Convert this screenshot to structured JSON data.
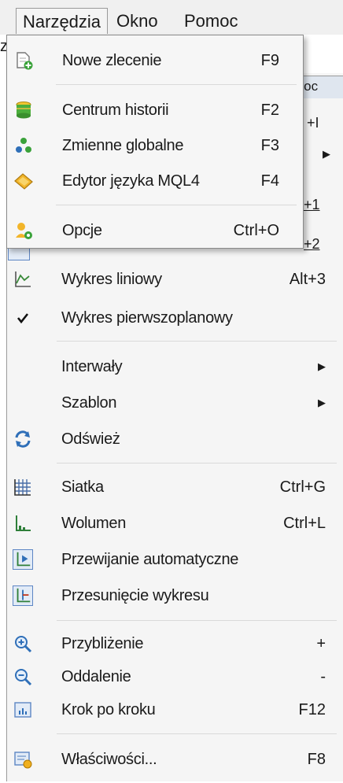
{
  "menubar": {
    "items": [
      {
        "label": "Narzędzia"
      },
      {
        "label": "Okno"
      },
      {
        "label": "Pomoc"
      }
    ]
  },
  "back_menu": {
    "partial_texts": [
      "moc",
      "+I",
      "+1",
      "+2"
    ],
    "items": [
      {
        "label": "Wykres liniowy",
        "shortcut": "Alt+3",
        "icon": "line-chart-icon"
      },
      {
        "label": "Wykres pierwszoplanowy",
        "shortcut": "",
        "icon": "checkmark-icon"
      },
      {
        "label": "Interwały",
        "shortcut": "",
        "submenu": true
      },
      {
        "label": "Szablon",
        "shortcut": "",
        "submenu": true
      },
      {
        "label": "Odśwież",
        "shortcut": "",
        "icon": "refresh-icon"
      },
      {
        "label": "Siatka",
        "shortcut": "Ctrl+G",
        "icon": "grid-icon"
      },
      {
        "label": "Wolumen",
        "shortcut": "Ctrl+L",
        "icon": "volume-icon"
      },
      {
        "label": "Przewijanie automatyczne",
        "shortcut": "",
        "icon": "auto-scroll-icon"
      },
      {
        "label": "Przesunięcie wykresu",
        "shortcut": "",
        "icon": "chart-shift-icon"
      },
      {
        "label": "Przybliżenie",
        "shortcut": "+",
        "icon": "zoom-in-icon"
      },
      {
        "label": "Oddalenie",
        "shortcut": "-",
        "icon": "zoom-out-icon"
      },
      {
        "label": "Krok po kroku",
        "shortcut": "F12",
        "icon": "step-icon"
      },
      {
        "label": "Właściwości...",
        "shortcut": "F8",
        "icon": "properties-icon"
      }
    ]
  },
  "dropdown": {
    "items": [
      {
        "label": "Nowe zlecenie",
        "shortcut": "F9",
        "icon": "new-order-icon"
      },
      {
        "label": "Centrum historii",
        "shortcut": "F2",
        "icon": "history-center-icon"
      },
      {
        "label": "Zmienne globalne",
        "shortcut": "F3",
        "icon": "global-variables-icon"
      },
      {
        "label": "Edytor języka MQL4",
        "shortcut": "F4",
        "icon": "mql4-editor-icon"
      },
      {
        "label": "Opcje",
        "shortcut": "Ctrl+O",
        "icon": "options-icon"
      }
    ]
  },
  "colors": {
    "menu_bg": "#f5f5f5",
    "border": "#8a8a8a",
    "icon_blue": "#2f6fb8",
    "icon_green": "#3a9a3a",
    "icon_yellow": "#e0a800"
  }
}
